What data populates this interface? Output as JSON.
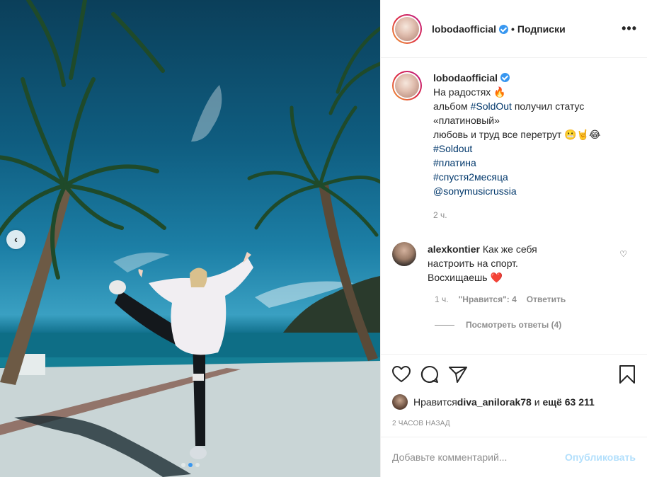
{
  "post": {
    "username": "lobodaofficial",
    "separator": "•",
    "follow_label": "Подписки",
    "more_label": "•••",
    "carousel_prev": "‹"
  },
  "caption": {
    "username": "lobodaofficial",
    "line1": "На радостях 🔥",
    "line2_pre": "альбом ",
    "line2_tag": "#SoldOut",
    "line2_post": " получил статус",
    "line3": "«платиновый»",
    "line4": "любовь и труд все перетрут 😬🤘😂",
    "tags": [
      "#Soldout",
      "#платина",
      "#спустя2месяца",
      "@sonymusicrussia"
    ],
    "time": "2 ч."
  },
  "comment": {
    "username": "alexkontier",
    "text": "Как же себя настроить на спорт. Восхищаешь ❤️",
    "time": "1 ч.",
    "likes": "\"Нравится\": 4",
    "reply": "Ответить",
    "view_replies": "Посмотреть ответы (4)",
    "heart": "♡"
  },
  "likes": {
    "prefix": "Нравится ",
    "user": "diva_anilorak78",
    "middle": " и ",
    "count": "ещё 63 211"
  },
  "date": "2 ЧАСОВ НАЗАД",
  "add_comment": {
    "placeholder": "Добавьте комментарий...",
    "publish": "Опубликовать"
  },
  "colors": {
    "link": "#00376b",
    "verified": "#3897f0",
    "publish_disabled": "#b2dffc"
  }
}
